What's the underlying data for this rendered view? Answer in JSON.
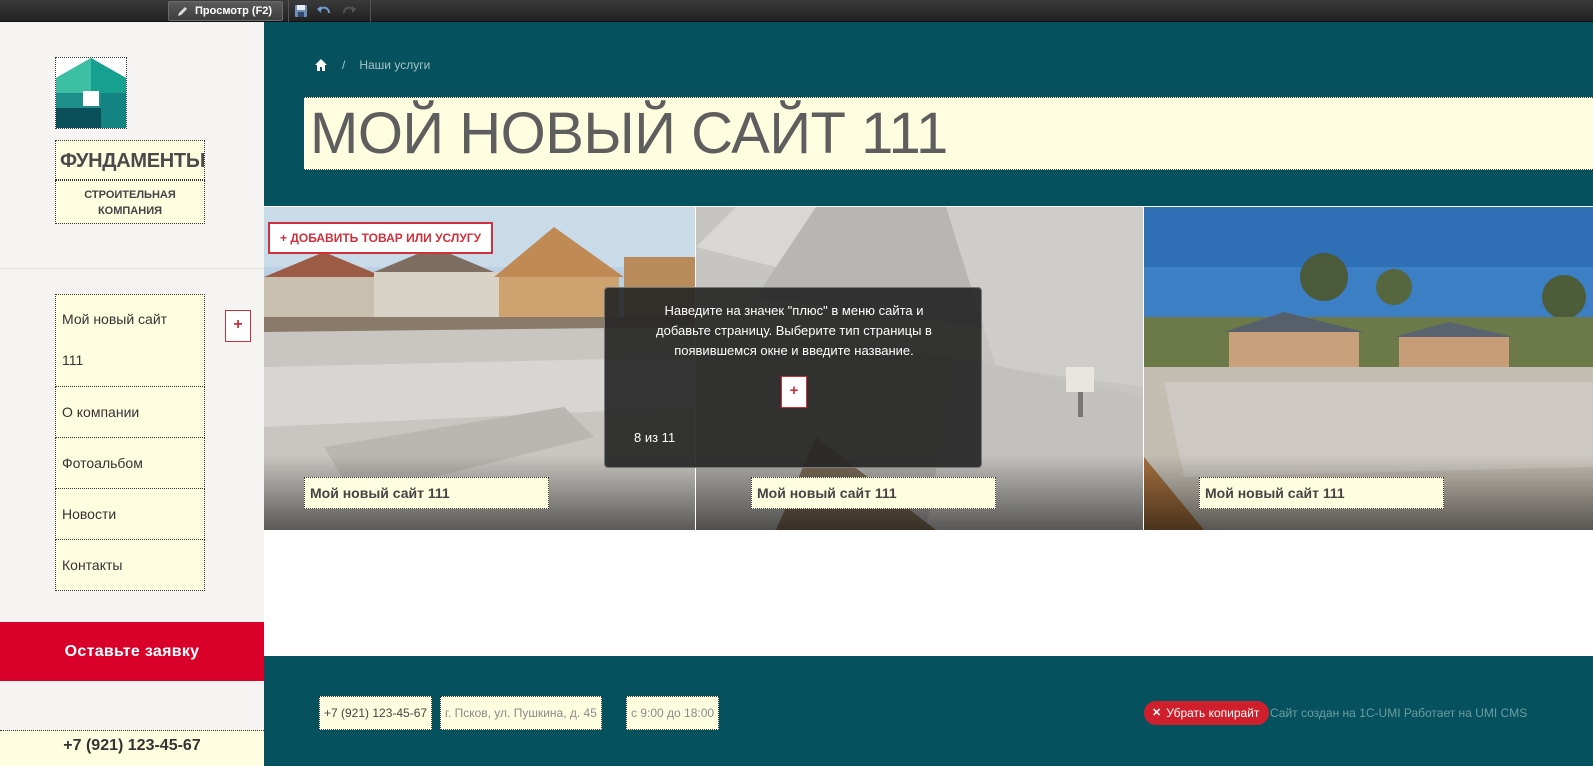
{
  "toolbar": {
    "preview_label": "Просмотр (F2)",
    "icons": [
      "pencil-icon",
      "save-icon",
      "undo-icon",
      "redo-icon"
    ]
  },
  "sidebar": {
    "brand_title": "ФУНДАМЕНТЫ",
    "brand_subtitle_line1": "СТРОИТЕЛЬНАЯ",
    "brand_subtitle_line2": "КОМПАНИЯ",
    "nav": [
      {
        "label_line1": "Мой новый сайт",
        "label_line2": "111"
      },
      {
        "label": "О компании"
      },
      {
        "label": "Фотоальбом"
      },
      {
        "label": "Новости"
      },
      {
        "label": "Контакты"
      }
    ],
    "add_plus": "+",
    "cta_label": "Оставьте заявку",
    "phone": "+7 (921) 123-45-67"
  },
  "header": {
    "breadcrumb_separator": "/",
    "breadcrumb_current": "Наши услуги",
    "title": "МОЙ НОВЫЙ САЙТ 111"
  },
  "gallery": {
    "add_product_label": "+ ДОБАВИТЬ ТОВАР ИЛИ УСЛУГУ",
    "items": [
      {
        "caption": "Мой новый сайт 111"
      },
      {
        "caption": "Мой новый сайт 111"
      },
      {
        "caption": "Мой новый сайт 111"
      }
    ],
    "tooltip": {
      "line1": "Наведите на значек \"плюс\" в меню сайта и",
      "line2": "добавьте страницу. Выберите тип страницы в",
      "line3": "появившемся окне и введите название.",
      "plus": "+",
      "counter": "8 из 11"
    }
  },
  "footer": {
    "phone": "+7 (921) 123-45-67",
    "address": "г. Псков, ул. Пушкина, д. 45",
    "hours": "с 9:00 до 18:00",
    "remove_copyright_label": "Убрать копирайт",
    "credits": "Сайт создан на 1С-UMI Работает на UMI CMS"
  },
  "colors": {
    "teal": "#05525e",
    "cta_red": "#d9002a",
    "editable_bg": "#fffde0",
    "accent_red": "#d0303c"
  }
}
